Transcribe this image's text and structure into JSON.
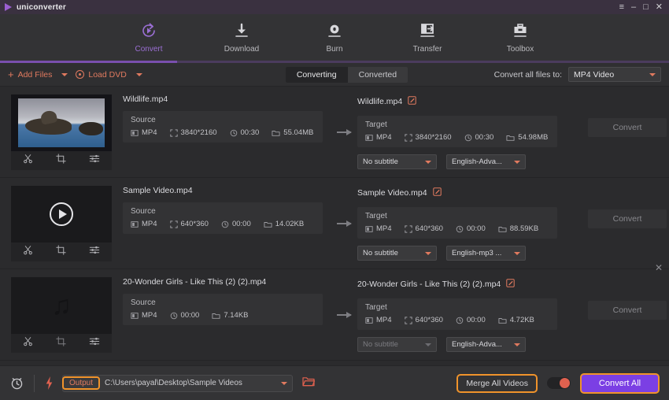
{
  "window": {
    "app_title": "uniconverter",
    "logo_icon": "play-triangle-icon",
    "controls": {
      "menu": "≡",
      "minimize": "–",
      "maximize": "□",
      "close": "✕"
    }
  },
  "nav": {
    "items": [
      {
        "label": "Convert",
        "icon": "convert-circular-arrow-icon",
        "active": true
      },
      {
        "label": "Download",
        "icon": "download-arrow-icon",
        "active": false
      },
      {
        "label": "Burn",
        "icon": "burn-disc-icon",
        "active": false
      },
      {
        "label": "Transfer",
        "icon": "transfer-device-icon",
        "active": false
      },
      {
        "label": "Toolbox",
        "icon": "toolbox-icon",
        "active": false
      }
    ]
  },
  "toolbar": {
    "add_files_label": "Add Files",
    "add_files_icon": "plus-icon",
    "load_dvd_label": "Load DVD",
    "load_dvd_icon": "dvd-disc-icon",
    "tabs": [
      {
        "label": "Converting",
        "active": true
      },
      {
        "label": "Converted",
        "active": false
      }
    ],
    "convert_all_to_label": "Convert all files to:",
    "convert_all_to_value": "MP4 Video"
  },
  "labels": {
    "source": "Source",
    "target": "Target",
    "convert_button": "Convert",
    "format_icon": "file-format-icon",
    "resolution_icon": "resolution-icon",
    "duration_icon": "clock-icon",
    "size_icon": "folder-icon",
    "edit_icon": "edit-pencil-icon",
    "trim_icon": "scissors-icon",
    "crop_icon": "crop-icon",
    "effect_icon": "effects-sliders-icon",
    "remove_icon": "close-icon",
    "arrow_icon": "right-arrow-icon"
  },
  "files": [
    {
      "thumb_kind": "video-seals",
      "thumb_overlay_icon": "none",
      "source_name": "Wildlife.mp4",
      "source": {
        "format": "MP4",
        "resolution": "3840*2160",
        "duration": "00:30",
        "size": "55.04MB"
      },
      "target_name": "Wildlife.mp4",
      "target": {
        "format": "MP4",
        "resolution": "3840*2160",
        "duration": "00:30",
        "size": "54.98MB"
      },
      "subtitle": "No subtitle",
      "subtitle_disabled": false,
      "audio": "English-Adva...",
      "audio_disabled": false,
      "convert_label": "Convert",
      "show_remove": false
    },
    {
      "thumb_kind": "video-placeholder",
      "thumb_overlay_icon": "play-circle-icon",
      "source_name": "Sample Video.mp4",
      "source": {
        "format": "MP4",
        "resolution": "640*360",
        "duration": "00:00",
        "size": "14.02KB"
      },
      "target_name": "Sample Video.mp4",
      "target": {
        "format": "MP4",
        "resolution": "640*360",
        "duration": "00:00",
        "size": "88.59KB"
      },
      "subtitle": "No subtitle",
      "subtitle_disabled": false,
      "audio": "English-mp3 ...",
      "audio_disabled": false,
      "convert_label": "Convert",
      "show_remove": true
    },
    {
      "thumb_kind": "audio",
      "thumb_overlay_icon": "music-note-icon",
      "source_name": "20-Wonder Girls - Like This (2) (2).mp4",
      "source": {
        "format": "MP4",
        "resolution": "",
        "duration": "00:00",
        "size": "7.14KB"
      },
      "target_name": "20-Wonder Girls - Like This (2) (2).mp4",
      "target": {
        "format": "MP4",
        "resolution": "640*360",
        "duration": "00:00",
        "size": "4.72KB"
      },
      "subtitle": "No subtitle",
      "subtitle_disabled": true,
      "audio": "English-Adva...",
      "audio_disabled": false,
      "convert_label": "Convert",
      "show_remove": false
    }
  ],
  "bottom": {
    "alarm_icon": "clock-alarm-icon",
    "speed_icon": "lightning-bolt-icon",
    "output_badge": "Output",
    "output_path": "C:\\Users\\payal\\Desktop\\Sample Videos",
    "folder_icon": "open-folder-icon",
    "merge_label": "Merge All Videos",
    "merge_toggle_on": false,
    "convert_all_label": "Convert All"
  },
  "colors": {
    "accent_purple": "#7b3fe4",
    "accent_orange": "#f0932b",
    "accent_salmon": "#e07a5f",
    "bg_dark": "#2b2b2d",
    "bg_panel": "#333335",
    "titlebar": "#3a3140"
  }
}
